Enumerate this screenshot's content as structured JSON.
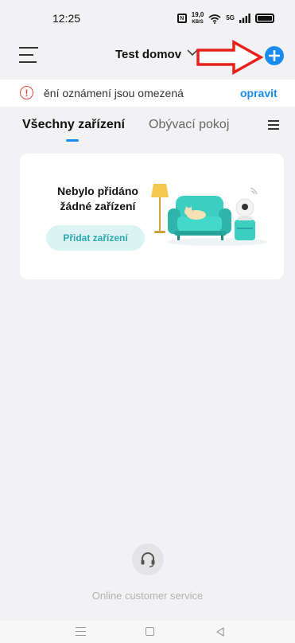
{
  "status_bar": {
    "time": "12:25",
    "speed_value": "19,0",
    "speed_unit": "KB/S",
    "nfc_label": "N",
    "signal_label": "5G"
  },
  "header": {
    "home_name": "Test domov",
    "menu_icon": "hamburger-menu-icon",
    "add_icon": "plus-circle-icon"
  },
  "notice": {
    "text": "ění oznámení jsou omezená",
    "action": "opravit",
    "icon": "!"
  },
  "tabs": {
    "items": [
      {
        "label": "Všechny zařízení",
        "active": true
      },
      {
        "label": "Obývací pokoj",
        "active": false
      }
    ]
  },
  "empty_state": {
    "title": "Nebylo přidáno žádné zařízení",
    "button_label": "Přidat zařízení"
  },
  "customer_service": {
    "label": "Online customer service"
  },
  "colors": {
    "accent": "#1a8cf0",
    "teal": "#2aa6ad",
    "warning": "#e04a3a",
    "annotation_arrow": "#e8201c"
  }
}
